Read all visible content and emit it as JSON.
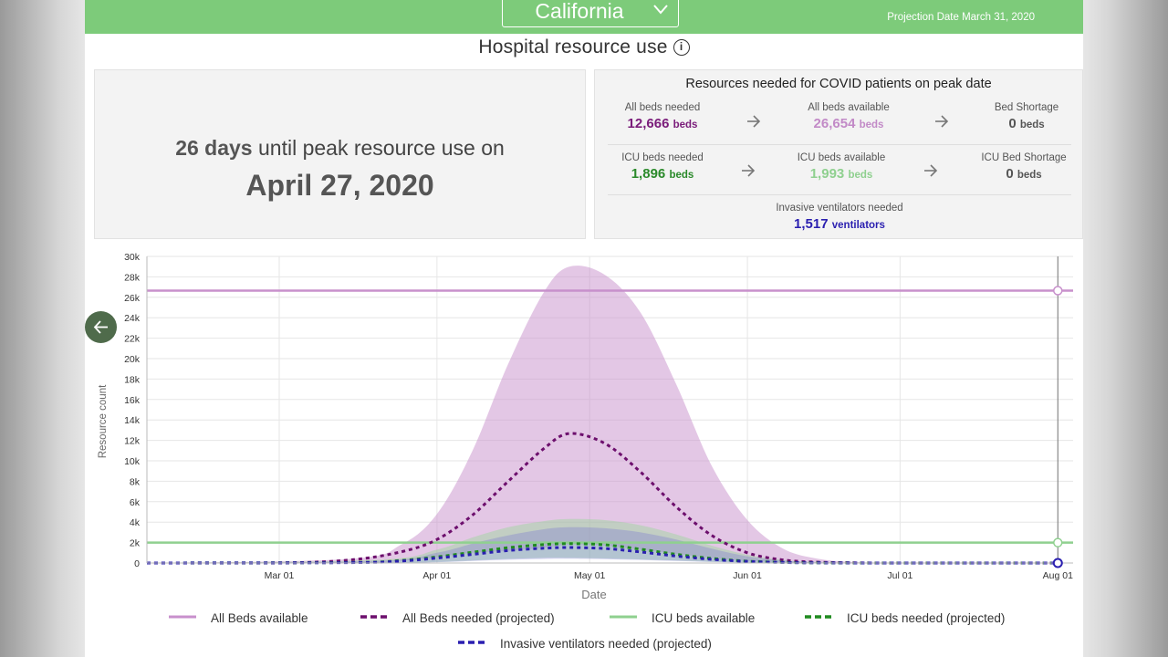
{
  "header": {
    "state": "California",
    "projection_date": "Projection Date March 31, 2020",
    "background_color": "#7dcb7a"
  },
  "section_title": "Hospital resource use",
  "peak": {
    "days": "26 days",
    "until_text": "until peak resource use on",
    "date": "April 27, 2020"
  },
  "resources": {
    "title": "Resources needed for COVID patients on peak date",
    "all_beds_needed": {
      "label": "All beds needed",
      "value": "12,666",
      "unit": "beds",
      "color": "#7a1c7a"
    },
    "all_beds_available": {
      "label": "All beds available",
      "value": "26,654",
      "unit": "beds",
      "color": "#c28ac7"
    },
    "bed_shortage": {
      "label": "Bed Shortage",
      "value": "0",
      "unit": "beds",
      "color": "#555555"
    },
    "icu_beds_needed": {
      "label": "ICU beds needed",
      "value": "1,896",
      "unit": "beds",
      "color": "#2a8a2a"
    },
    "icu_beds_available": {
      "label": "ICU beds available",
      "value": "1,993",
      "unit": "beds",
      "color": "#8fd08f"
    },
    "icu_bed_shortage": {
      "label": "ICU Bed Shortage",
      "value": "0",
      "unit": "beds",
      "color": "#555555"
    },
    "ventilators_needed": {
      "label": "Invasive ventilators needed",
      "value": "1,517",
      "unit": "ventilators",
      "color": "#2a1fb0"
    }
  },
  "chart_data": {
    "type": "line",
    "xlabel": "Date",
    "ylabel": "Resource count",
    "x_start": "2020-02-04",
    "x_end": "2020-08-04",
    "x_ticks": [
      {
        "date": "2020-03-01",
        "label": "Mar 01"
      },
      {
        "date": "2020-04-01",
        "label": "Apr 01"
      },
      {
        "date": "2020-05-01",
        "label": "May 01"
      },
      {
        "date": "2020-06-01",
        "label": "Jun 01"
      },
      {
        "date": "2020-07-01",
        "label": "Jul 01"
      },
      {
        "date": "2020-08-01",
        "label": "Aug 01"
      }
    ],
    "ylim": [
      0,
      30000
    ],
    "y_ticks": [
      0,
      2000,
      4000,
      6000,
      8000,
      10000,
      12000,
      14000,
      16000,
      18000,
      20000,
      22000,
      24000,
      26000,
      28000,
      30000
    ],
    "y_tick_labels": [
      "0",
      "2k",
      "4k",
      "6k",
      "8k",
      "10k",
      "12k",
      "14k",
      "16k",
      "18k",
      "20k",
      "22k",
      "24k",
      "26k",
      "28k",
      "30k"
    ],
    "grid": true,
    "cursor_date": "2020-08-01",
    "legend_position": "bottom",
    "series": [
      {
        "name": "All Beds available",
        "kind": "hline",
        "value": 26654,
        "color": "#c890cc"
      },
      {
        "name": "All Beds needed (projected)",
        "kind": "dashed",
        "color": "#6d0f6d",
        "x": [
          "2020-02-04",
          "2020-03-01",
          "2020-03-15",
          "2020-03-25",
          "2020-04-01",
          "2020-04-08",
          "2020-04-15",
          "2020-04-22",
          "2020-04-27",
          "2020-05-04",
          "2020-05-11",
          "2020-05-18",
          "2020-05-25",
          "2020-06-01",
          "2020-06-08",
          "2020-06-15",
          "2020-06-22",
          "2020-07-01",
          "2020-08-01"
        ],
        "y": [
          0,
          0,
          300,
          1100,
          2300,
          4700,
          8000,
          11200,
          12666,
          11700,
          8900,
          5500,
          2700,
          1000,
          300,
          80,
          20,
          0,
          0
        ]
      },
      {
        "name": "All Beds needed (uncertainty)",
        "kind": "band",
        "color": "#c890cc",
        "x": [
          "2020-02-04",
          "2020-03-15",
          "2020-03-25",
          "2020-04-01",
          "2020-04-08",
          "2020-04-15",
          "2020-04-22",
          "2020-04-27",
          "2020-05-04",
          "2020-05-11",
          "2020-05-18",
          "2020-05-25",
          "2020-06-01",
          "2020-06-08",
          "2020-06-15",
          "2020-06-22",
          "2020-07-01",
          "2020-08-01"
        ],
        "upper": [
          0,
          400,
          1800,
          4800,
          11000,
          19500,
          26500,
          29000,
          28200,
          24500,
          17500,
          9500,
          4200,
          1400,
          400,
          100,
          0,
          0
        ],
        "lower": [
          0,
          0,
          200,
          600,
          1000,
          1200,
          1500,
          1800,
          1700,
          1300,
          900,
          500,
          200,
          80,
          20,
          0,
          0,
          0
        ]
      },
      {
        "name": "ICU beds available",
        "kind": "hline",
        "value": 1993,
        "color": "#8fd08f"
      },
      {
        "name": "ICU beds needed (projected)",
        "kind": "dashed",
        "color": "#1f8a1f",
        "x": [
          "2020-02-04",
          "2020-03-15",
          "2020-03-25",
          "2020-04-01",
          "2020-04-08",
          "2020-04-15",
          "2020-04-22",
          "2020-04-27",
          "2020-05-04",
          "2020-05-11",
          "2020-05-18",
          "2020-05-25",
          "2020-06-01",
          "2020-06-08",
          "2020-06-15",
          "2020-07-01",
          "2020-08-01"
        ],
        "y": [
          0,
          50,
          250,
          600,
          1050,
          1500,
          1800,
          1896,
          1780,
          1350,
          850,
          450,
          180,
          60,
          20,
          0,
          0
        ]
      },
      {
        "name": "ICU beds needed (uncertainty)",
        "kind": "band",
        "color": "#9ad69a",
        "x": [
          "2020-02-04",
          "2020-03-20",
          "2020-04-01",
          "2020-04-08",
          "2020-04-15",
          "2020-04-22",
          "2020-04-27",
          "2020-05-04",
          "2020-05-11",
          "2020-05-18",
          "2020-05-25",
          "2020-06-01",
          "2020-06-08",
          "2020-06-15",
          "2020-07-01",
          "2020-08-01"
        ],
        "upper": [
          0,
          300,
          1300,
          2500,
          3500,
          4100,
          4300,
          4200,
          3700,
          2800,
          1700,
          800,
          300,
          80,
          0,
          0
        ],
        "lower": [
          0,
          0,
          100,
          250,
          400,
          500,
          500,
          450,
          350,
          250,
          120,
          50,
          10,
          0,
          0,
          0
        ]
      },
      {
        "name": "Invasive ventilators needed (projected)",
        "kind": "dashed",
        "color": "#2a1fb0",
        "x": [
          "2020-02-04",
          "2020-03-15",
          "2020-03-25",
          "2020-04-01",
          "2020-04-08",
          "2020-04-15",
          "2020-04-22",
          "2020-04-27",
          "2020-05-04",
          "2020-05-11",
          "2020-05-18",
          "2020-05-25",
          "2020-06-01",
          "2020-06-08",
          "2020-06-15",
          "2020-07-01",
          "2020-08-01"
        ],
        "y": [
          0,
          40,
          200,
          480,
          850,
          1220,
          1450,
          1517,
          1420,
          1080,
          680,
          360,
          150,
          50,
          15,
          0,
          0
        ]
      },
      {
        "name": "Invasive ventilators needed (uncertainty)",
        "kind": "band",
        "color": "#7a78d0",
        "x": [
          "2020-02-04",
          "2020-03-20",
          "2020-04-01",
          "2020-04-08",
          "2020-04-15",
          "2020-04-22",
          "2020-04-27",
          "2020-05-04",
          "2020-05-11",
          "2020-05-18",
          "2020-05-25",
          "2020-06-01",
          "2020-06-08",
          "2020-06-15",
          "2020-07-01",
          "2020-08-01"
        ],
        "upper": [
          0,
          200,
          1000,
          1900,
          2700,
          3300,
          3500,
          3400,
          3000,
          2300,
          1400,
          650,
          250,
          60,
          0,
          0
        ],
        "lower": [
          0,
          0,
          80,
          200,
          320,
          400,
          420,
          380,
          300,
          200,
          100,
          40,
          10,
          0,
          0,
          0
        ]
      }
    ],
    "legend": [
      {
        "label": "All Beds available",
        "style": "solid",
        "color": "#c890cc"
      },
      {
        "label": "All Beds needed (projected)",
        "style": "dashed",
        "color": "#6d0f6d"
      },
      {
        "label": "ICU beds available",
        "style": "solid",
        "color": "#8fd08f"
      },
      {
        "label": "ICU beds needed (projected)",
        "style": "dashed",
        "color": "#1f8a1f"
      },
      {
        "label": "Invasive ventilators needed (projected)",
        "style": "dashed",
        "color": "#2a1fb0"
      }
    ]
  }
}
